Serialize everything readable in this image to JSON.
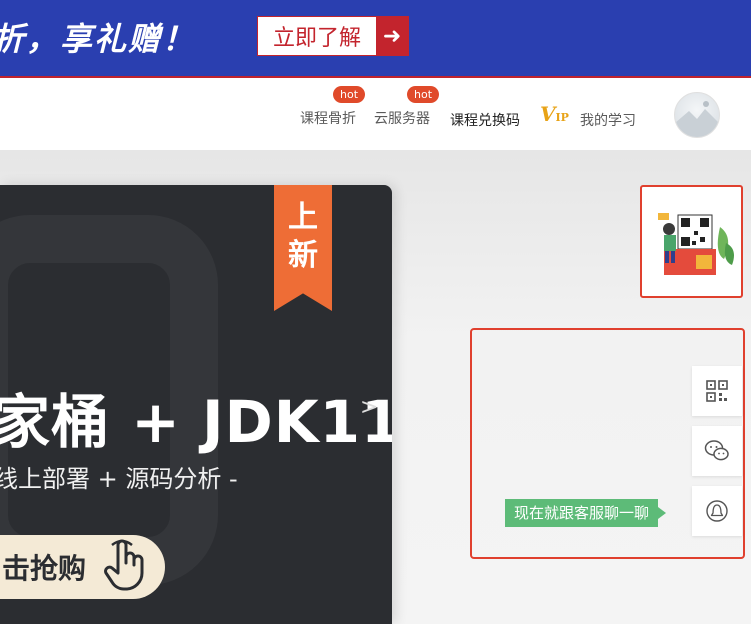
{
  "promo": {
    "text": "折，享礼赠！",
    "button_label": "立即了解",
    "button_arrow": "➜"
  },
  "nav": {
    "items": [
      {
        "label": "课程骨折",
        "badge": "hot"
      },
      {
        "label": "云服务器",
        "badge": "hot"
      },
      {
        "label": "课程兑换码"
      },
      {
        "label": "我的学习"
      }
    ],
    "vip_main": "V",
    "vip_sub": "IP"
  },
  "banner": {
    "ribbon_line1": "上",
    "ribbon_line2": "新",
    "title": "家桶 + JDK11",
    "arrow": ">",
    "subtitle": "线上部署 + 源码分析 -",
    "cta": "击抢购"
  },
  "chat": {
    "tip": "现在就跟客服聊一聊"
  },
  "colors": {
    "promo_bg": "#2a3fb0",
    "accent_red": "#c3242d",
    "ribbon": "#ee6d36",
    "chat_green": "#5dbb78"
  }
}
